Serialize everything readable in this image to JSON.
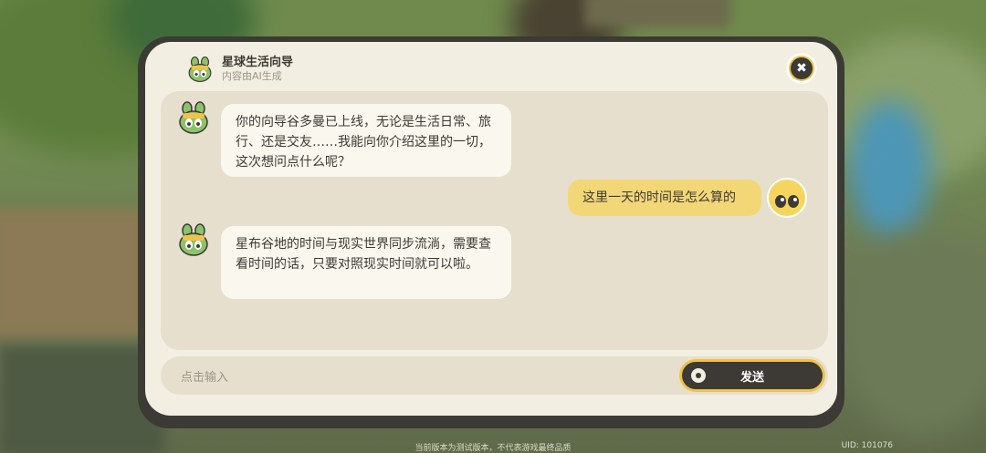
{
  "header": {
    "title": "星球生活向导",
    "subtitle": "内容由AI生成"
  },
  "close_button": {
    "icon": "close-icon",
    "label": "✖"
  },
  "messages": [
    {
      "sender": "guide",
      "text": "你的向导谷多曼已上线，无论是生活日常、旅行、还是交友……我能向你介绍这里的一切，这次想问点什么呢？"
    },
    {
      "sender": "user",
      "text": "这里一天的时间是怎么算的"
    },
    {
      "sender": "guide",
      "text": "星布谷地的时间与现实世界同步流淌，需要查看时间的话，只要对照现实时间就可以啦。"
    }
  ],
  "input": {
    "placeholder": "点击输入"
  },
  "send_button": {
    "label": "发送",
    "icon": "microphone-dot-icon"
  },
  "footer": {
    "note": "当前版本为测试版本，不代表游戏最终品质",
    "uid": "UID: 101076"
  },
  "colors": {
    "panel_bg": "#f3eee2",
    "chat_bg": "#e6dfcd",
    "frame": "#3b3a35",
    "accent_yellow": "#f1c24a",
    "user_bubble": "#f3d777"
  }
}
